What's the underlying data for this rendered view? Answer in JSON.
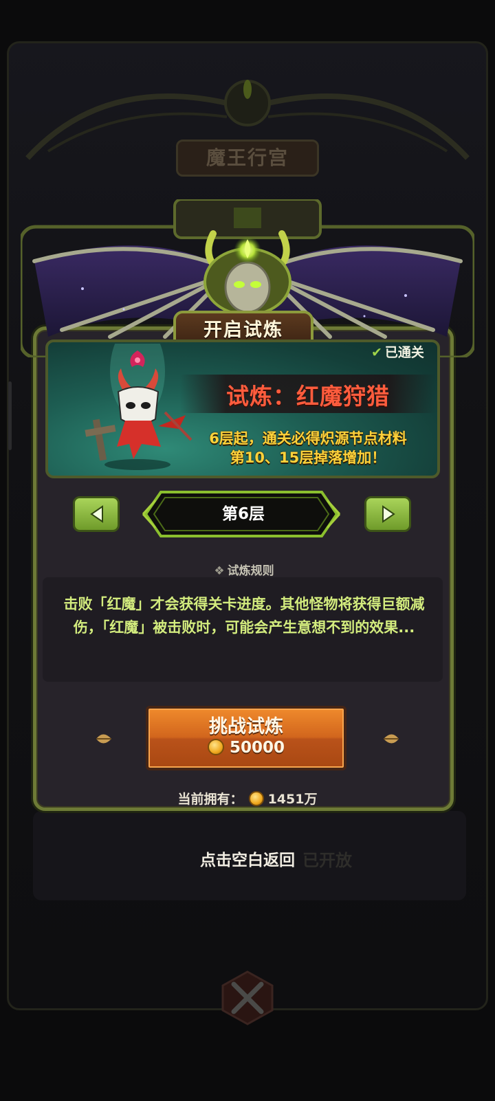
{
  "background": {
    "title": "魔王行宫",
    "unlocked_hint": "已开放"
  },
  "dialog": {
    "title": "开启试炼",
    "cleared_badge": "已通关",
    "trial_name": "试炼：红魔狩猎",
    "trial_desc_line1": "6层起，通关必得炽源节点材料",
    "trial_desc_line2": "第10、15层掉落增加！",
    "floor_label": "第6层",
    "rules_title": "试炼规则",
    "rules_text": "击败「红魔」才会获得关卡进度。其他怪物将获得巨额减伤，「红魔」被击败时，可能会产生意想不到的效果...",
    "challenge_label": "挑战试炼",
    "challenge_cost": "50000",
    "owned_label": "当前拥有：",
    "owned_amount": "1451万",
    "dismiss_hint": "点击空白返回"
  },
  "colors": {
    "accent_green": "#8c9a3c",
    "trial_name_red": "#ff5c3d",
    "desc_yellow": "#ffd23a",
    "button_orange": "#d2661d"
  }
}
